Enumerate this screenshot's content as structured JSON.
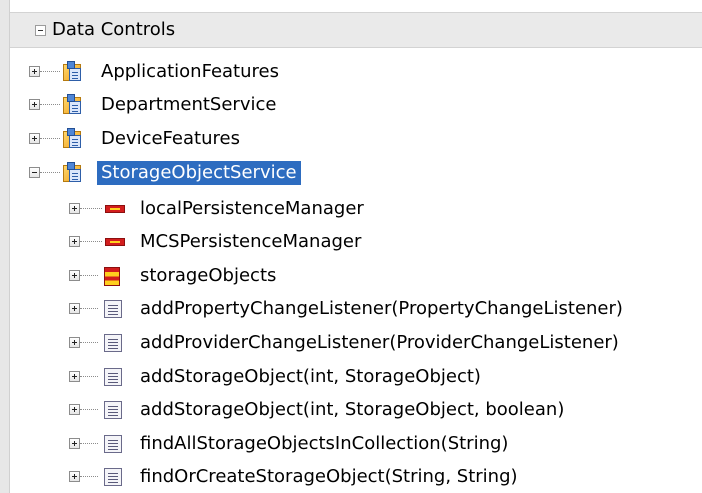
{
  "header": {
    "label": "Data Controls"
  },
  "tree": {
    "services": [
      {
        "label": "ApplicationFeatures",
        "expanded": false,
        "selected": false
      },
      {
        "label": "DepartmentService",
        "expanded": false,
        "selected": false
      },
      {
        "label": "DeviceFeatures",
        "expanded": false,
        "selected": false
      },
      {
        "label": "StorageObjectService",
        "expanded": true,
        "selected": true
      }
    ],
    "children": [
      {
        "label": "localPersistenceManager",
        "icon": "attribute-icon"
      },
      {
        "label": "MCSPersistenceManager",
        "icon": "attribute-icon"
      },
      {
        "label": "storageObjects",
        "icon": "collection-icon"
      },
      {
        "label": "addPropertyChangeListener(PropertyChangeListener)",
        "icon": "method-icon"
      },
      {
        "label": "addProviderChangeListener(ProviderChangeListener)",
        "icon": "method-icon"
      },
      {
        "label": "addStorageObject(int, StorageObject)",
        "icon": "method-icon"
      },
      {
        "label": "addStorageObject(int, StorageObject, boolean)",
        "icon": "method-icon"
      },
      {
        "label": "findAllStorageObjectsInCollection(String)",
        "icon": "method-icon"
      },
      {
        "label": "findOrCreateStorageObject(String, String)",
        "icon": "method-icon"
      }
    ]
  },
  "colors": {
    "selection": "#2d6cc0",
    "header_bg": "#eaeaea"
  }
}
